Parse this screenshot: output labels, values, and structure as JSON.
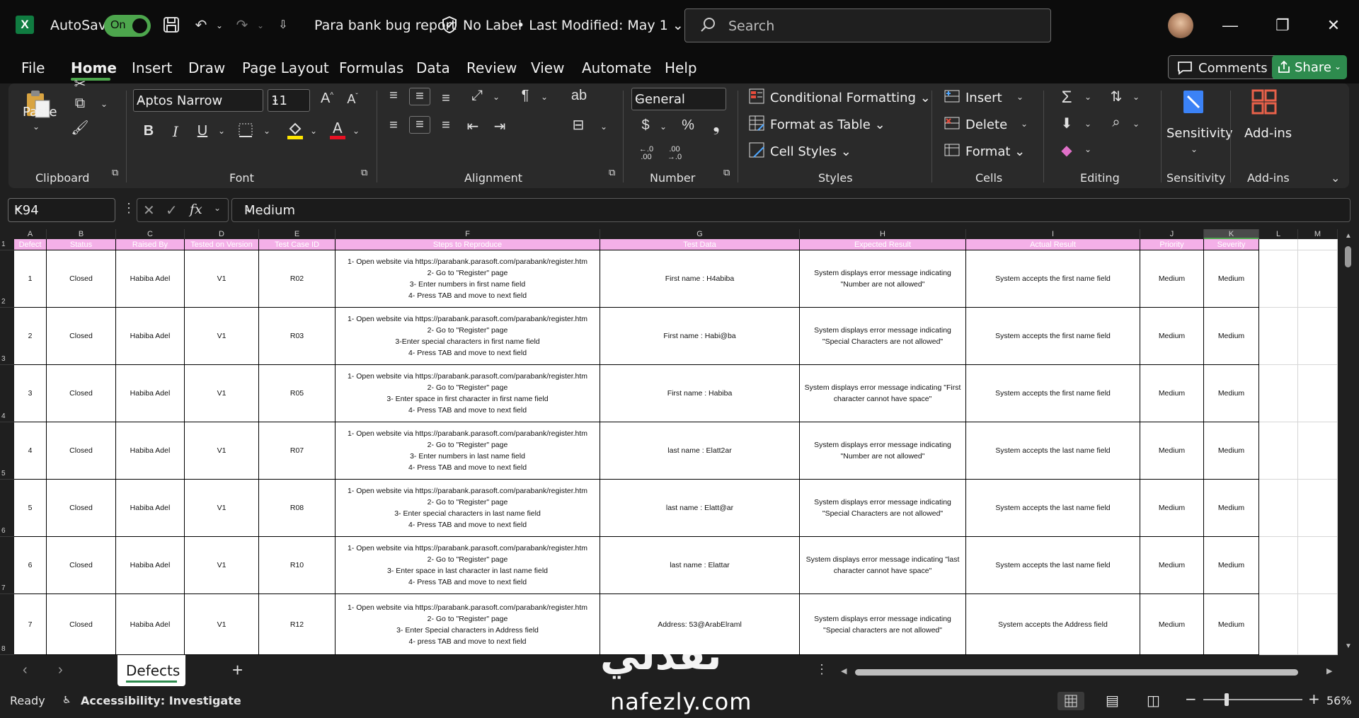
{
  "app": {
    "autosave_label": "AutoSave",
    "autosave_state": "On",
    "document_title": "Para bank bug report",
    "label_status": "No Label",
    "last_modified": "Last Modified: May 1",
    "search_placeholder": "Search",
    "brand_color": "#107c41",
    "accent_color": "#4da64d"
  },
  "menu": {
    "items": [
      "File",
      "Home",
      "Insert",
      "Draw",
      "Page Layout",
      "Formulas",
      "Data",
      "Review",
      "View",
      "Automate",
      "Help"
    ],
    "active": "Home",
    "comments_label": "Comments",
    "share_label": "Share"
  },
  "ribbon": {
    "clipboard": {
      "label": "Clipboard",
      "paste_label": "Paste"
    },
    "font": {
      "label": "Font",
      "family": "Aptos Narrow",
      "size": "11"
    },
    "alignment": {
      "label": "Alignment"
    },
    "number": {
      "label": "Number",
      "format": "General",
      "dec_increase": ".00\n→.0",
      "dec_decrease": ".00\n→.0"
    },
    "styles": {
      "label": "Styles",
      "conditional_formatting": "Conditional Formatting",
      "format_as_table": "Format as Table",
      "cell_styles": "Cell Styles"
    },
    "cells": {
      "label": "Cells",
      "insert": "Insert",
      "delete": "Delete",
      "format": "Format"
    },
    "editing": {
      "label": "Editing"
    },
    "sensitivity": {
      "label": "Sensitivity",
      "button": "Sensitivity"
    },
    "addins": {
      "label": "Add-ins",
      "button": "Add-ins"
    }
  },
  "formula_bar": {
    "name_box": "K94",
    "fx": "fx",
    "value": "Medium"
  },
  "sheet": {
    "columns": [
      "A",
      "B",
      "C",
      "D",
      "E",
      "F",
      "G",
      "H",
      "I",
      "J",
      "K",
      "L",
      "M"
    ],
    "selected_column": "K",
    "header_row": [
      "Defect",
      "Status",
      "Raised By",
      "Tested on Version",
      "Test Case ID",
      "Steps to Reproduce",
      "Test Data",
      "Expected Result",
      "Actual Result",
      "Priority",
      "Severity"
    ],
    "row_numbers": [
      "1",
      "2",
      "3",
      "4",
      "5",
      "6",
      "7",
      "8"
    ],
    "rows": [
      {
        "defect": "1",
        "status": "Closed",
        "raised_by": "Habiba Adel",
        "version": "V1",
        "tc_id": "R02",
        "steps": "1- Open website via https://parabank.parasoft.com/parabank/register.htm\n2- Go to \"Register\" page\n3- Enter numbers in first name field\n4- Press TAB and move to next field",
        "test_data": "First name : H4abiba",
        "expected": "System displays error message indicating\n\"Number are not allowed\"",
        "actual": "System accepts the first name field",
        "priority": "Medium",
        "severity": "Medium"
      },
      {
        "defect": "2",
        "status": "Closed",
        "raised_by": "Habiba Adel",
        "version": "V1",
        "tc_id": "R03",
        "steps": "1- Open website via https://parabank.parasoft.com/parabank/register.htm\n2- Go to \"Register\" page\n3-Enter special characters in first name field\n4- Press TAB and move to next field",
        "test_data": "First name : Habi@ba",
        "expected": "System displays error message indicating\n\"Special Characters are not allowed\"",
        "actual": "System accepts the first name field",
        "priority": "Medium",
        "severity": "Medium"
      },
      {
        "defect": "3",
        "status": "Closed",
        "raised_by": "Habiba Adel",
        "version": "V1",
        "tc_id": "R05",
        "steps": "1- Open website via https://parabank.parasoft.com/parabank/register.htm\n2- Go to \"Register\" page\n3- Enter space in first character in first name field\n4- Press TAB and move to next field",
        "test_data": "First name :  Habiba",
        "expected": "System displays error message indicating \"First\ncharacter cannot have space\"",
        "actual": "System accepts the first name field",
        "priority": "Medium",
        "severity": "Medium"
      },
      {
        "defect": "4",
        "status": "Closed",
        "raised_by": "Habiba Adel",
        "version": "V1",
        "tc_id": "R07",
        "steps": "1- Open website via https://parabank.parasoft.com/parabank/register.htm\n2- Go to \"Register\" page\n3- Enter numbers in last name field\n4- Press TAB and move to next field",
        "test_data": "last name : Elatt2ar",
        "expected": "System displays error message indicating\n\"Number are not allowed\"",
        "actual": "System accepts the last name field",
        "priority": "Medium",
        "severity": "Medium"
      },
      {
        "defect": "5",
        "status": "Closed",
        "raised_by": "Habiba Adel",
        "version": "V1",
        "tc_id": "R08",
        "steps": "1- Open website via https://parabank.parasoft.com/parabank/register.htm\n2- Go to \"Register\" page\n3- Enter special characters in last name field\n4- Press TAB and move to next field",
        "test_data": "last name : Elatt@ar",
        "expected": "System displays error message indicating\n\"Special Characters are not allowed\"",
        "actual": "System accepts the last name field",
        "priority": "Medium",
        "severity": "Medium"
      },
      {
        "defect": "6",
        "status": "Closed",
        "raised_by": "Habiba Adel",
        "version": "V1",
        "tc_id": "R10",
        "steps": "1- Open website via https://parabank.parasoft.com/parabank/register.htm\n2- Go to \"Register\" page\n3- Enter space in last character in last name field\n4- Press TAB and move to next field",
        "test_data": "last name :  Elattar",
        "expected": "System displays error message indicating \"last\ncharacter cannot have space\"",
        "actual": "System accepts the last name field",
        "priority": "Medium",
        "severity": "Medium"
      },
      {
        "defect": "7",
        "status": "Closed",
        "raised_by": "Habiba Adel",
        "version": "V1",
        "tc_id": "R12",
        "steps": "1- Open website via https://parabank.parasoft.com/parabank/register.htm\n2- Go to \"Register\" page\n3- Enter Special characters in Address field\n4- press TAB and move to next field",
        "test_data": "Address: 53@ArabElraml",
        "expected": "System displays error message indicating\n\"Special characters are not allowed\"",
        "actual": "System accepts the Address field",
        "priority": "Medium",
        "severity": "Medium"
      }
    ],
    "active_tab": "Defects"
  },
  "status": {
    "ready": "Ready",
    "accessibility": "Accessibility: Investigate",
    "zoom": "56%"
  },
  "watermark": {
    "arabic": "نفذلي",
    "latin": "nafezly.com"
  }
}
